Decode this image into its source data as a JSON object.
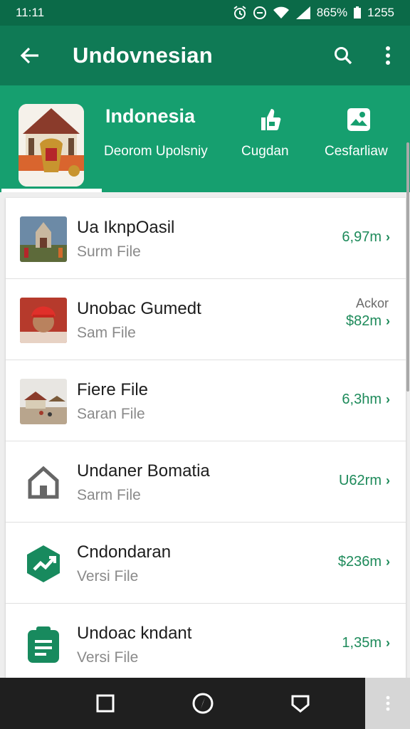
{
  "status_bar": {
    "time": "11:11",
    "battery": "865%",
    "clock": "1255"
  },
  "app_bar": {
    "title": "Undovnesian"
  },
  "tabs": [
    {
      "title": "Indonesia",
      "label": "Deorom Upolsniy",
      "selected": true
    },
    {
      "label": "Cugdan",
      "icon": "thumbs-up-icon"
    },
    {
      "label": "Cesfarliaw",
      "icon": "photo-icon"
    }
  ],
  "list": {
    "items": [
      {
        "title": "Ua IknpOasil",
        "subtitle": "Surm File",
        "size": "6,97m",
        "thumb": "temple-photo"
      },
      {
        "title": "Unobac Gumedt",
        "subtitle": "Sam File",
        "size": "$82m",
        "extra": "Ackor",
        "thumb": "person-photo"
      },
      {
        "title": "Fiere File",
        "subtitle": "Saran File",
        "size": "6,3hm",
        "thumb": "village-photo"
      },
      {
        "title": "Undaner Bomatia",
        "subtitle": "Sarm File",
        "size": "U62rm",
        "thumb": "home-icon"
      },
      {
        "title": "Cndondaran",
        "subtitle": "Versi File",
        "size": "$236m",
        "thumb": "trend-icon"
      },
      {
        "title": "Undoac kndant",
        "subtitle": "Versi File",
        "size": "1,35m",
        "thumb": "document-icon"
      }
    ]
  },
  "colors": {
    "primary": "#0f7a55",
    "status": "#0b6a48",
    "tabs": "#169f6f",
    "accent": "#1d8a5a"
  }
}
